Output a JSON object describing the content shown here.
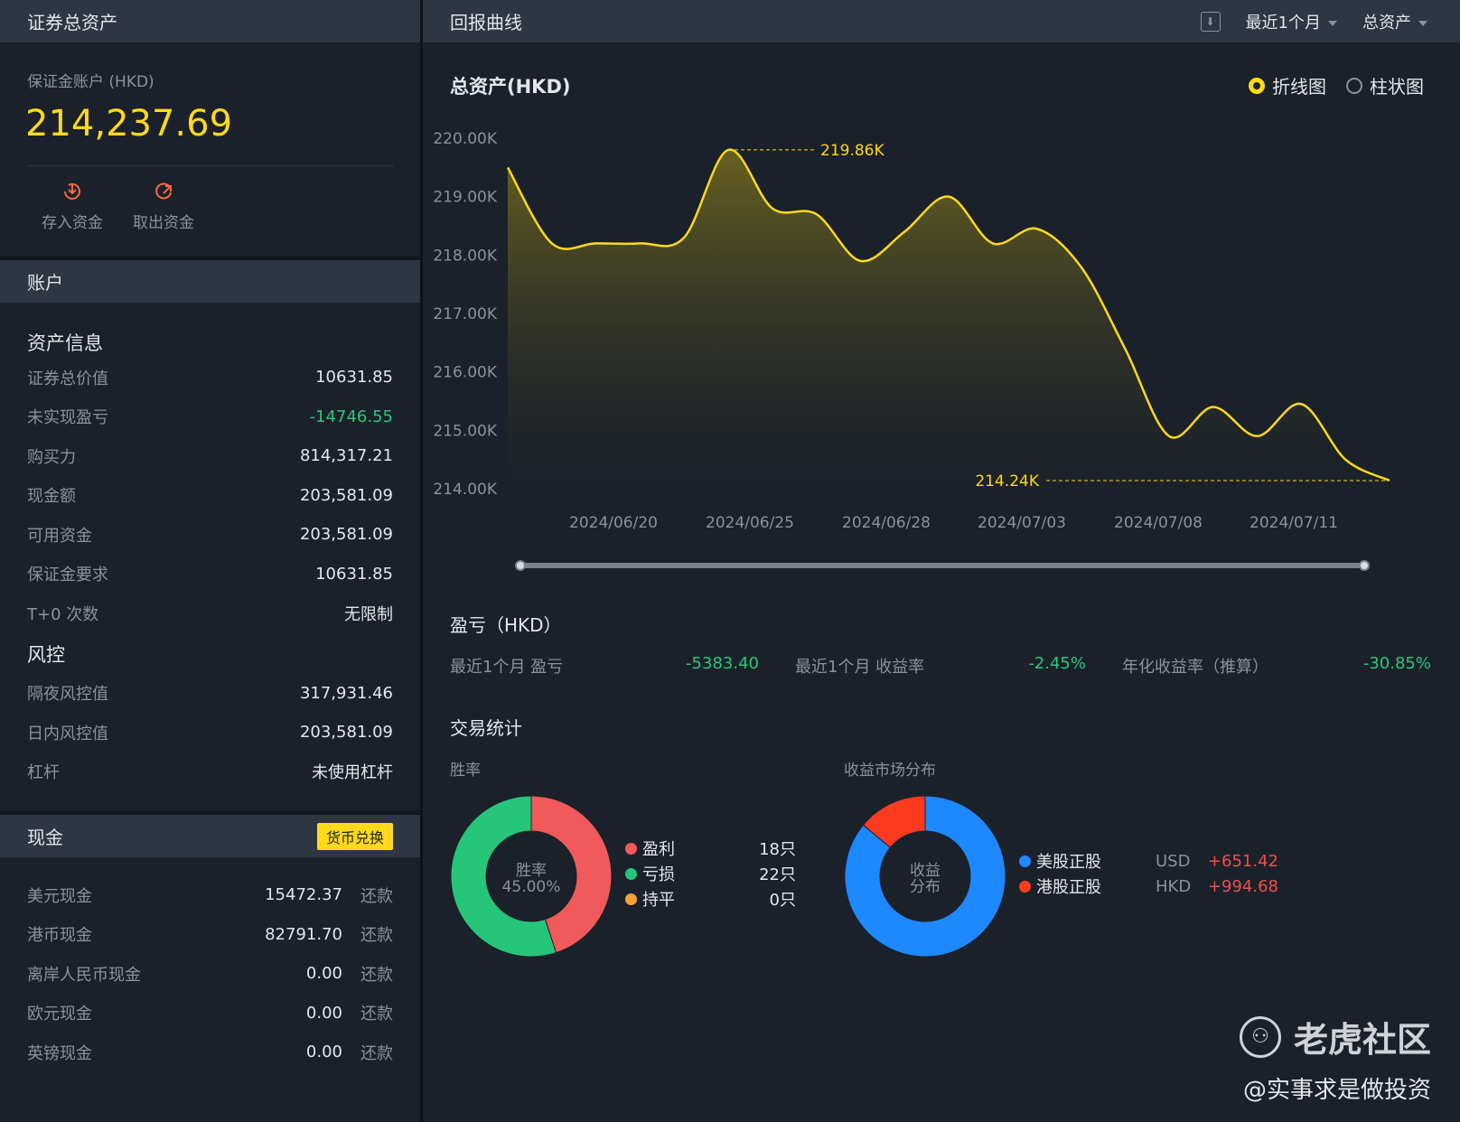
{
  "left": {
    "header_title": "证券总资产",
    "account_label": "保证金账户 (HKD)",
    "total_value": "214,237.69",
    "actions": [
      {
        "label": "存入资金",
        "icon": "deposit-icon"
      },
      {
        "label": "取出资金",
        "icon": "withdraw-icon"
      }
    ],
    "account_section": "账户",
    "asset_info_title": "资产信息",
    "asset_rows": [
      {
        "label": "证券总价值",
        "value": "10631.85"
      },
      {
        "label": "未实现盈亏",
        "value": "-14746.55"
      },
      {
        "label": "购买力",
        "value": "814,317.21"
      },
      {
        "label": "现金额",
        "value": "203,581.09"
      },
      {
        "label": "可用资金",
        "value": "203,581.09"
      },
      {
        "label": "保证金要求",
        "value": "10631.85"
      },
      {
        "label": "T+0 次数",
        "value": "无限制"
      }
    ],
    "risk_title": "风控",
    "risk_rows": [
      {
        "label": "隔夜风控值",
        "value": "317,931.46"
      },
      {
        "label": "日内风控值",
        "value": "203,581.09"
      },
      {
        "label": "杠杆",
        "value": "未使用杠杆"
      }
    ],
    "cash_section": "现金",
    "fx_button": "货币兑换",
    "repay_label": "还款",
    "cash_rows": [
      {
        "label": "美元现金",
        "value": "15472.37"
      },
      {
        "label": "港币现金",
        "value": "82791.70"
      },
      {
        "label": "离岸人民币现金",
        "value": "0.00"
      },
      {
        "label": "欧元现金",
        "value": "0.00"
      },
      {
        "label": "英镑现金",
        "value": "0.00"
      }
    ]
  },
  "right": {
    "header_title": "回报曲线",
    "period_select": "最近1个月",
    "metric_select": "总资产",
    "chart_title": "总资产(HKD)",
    "radio_line": "折线图",
    "radio_bar": "柱状图",
    "pl_title": "盈亏（HKD）",
    "pl_items": [
      {
        "label": "最近1个月 盈亏",
        "value": "-5383.40"
      },
      {
        "label": "最近1个月 收益率",
        "value": "-2.45%"
      },
      {
        "label": "年化收益率（推算）",
        "value": "-30.85%"
      }
    ],
    "trade_stats_title": "交易统计",
    "winrate_title": "胜率",
    "winrate_center_label": "胜率",
    "winrate_center_value": "45.00%",
    "winrate_legend": [
      {
        "label": "盈利",
        "count": "18只",
        "color": "#f05a5a"
      },
      {
        "label": "亏损",
        "count": "22只",
        "color": "#26c67a"
      },
      {
        "label": "持平",
        "count": "0只",
        "color": "#f7a13a"
      }
    ],
    "market_title": "收益市场分布",
    "market_center_line1": "收益",
    "market_center_line2": "分布",
    "market_legend": [
      {
        "label": "美股正股",
        "currency": "USD",
        "amount": "+651.42",
        "color": "#1e88ff"
      },
      {
        "label": "港股正股",
        "currency": "HKD",
        "amount": "+994.68",
        "color": "#ff3b1f"
      }
    ],
    "watermark_brand": "老虎社区",
    "watermark_user": "@实事求是做投资"
  },
  "chart_data": {
    "type": "line",
    "title": "总资产(HKD)",
    "x_ticks": [
      "2024/06/20",
      "2024/06/25",
      "2024/06/28",
      "2024/07/03",
      "2024/07/08",
      "2024/07/11"
    ],
    "y_ticks": [
      "220.00K",
      "219.00K",
      "218.00K",
      "217.00K",
      "216.00K",
      "215.00K",
      "214.00K"
    ],
    "ylim": [
      214000,
      220000
    ],
    "max_label": "219.86K",
    "min_label": "214.24K",
    "series": [
      {
        "values": [
          219500,
          218200,
          218200,
          218200,
          218300,
          219800,
          218800,
          218700,
          217900,
          218400,
          219000,
          218200,
          218450,
          217800,
          216400,
          214900,
          215400,
          214900,
          215450,
          214500,
          214140
        ]
      }
    ],
    "line_color": "#ffd91a",
    "grid": false
  },
  "winrate_chart": {
    "type": "pie",
    "values": [
      45,
      55
    ],
    "colors": [
      "#f05a5a",
      "#26c67a"
    ]
  },
  "market_chart": {
    "type": "pie",
    "values": [
      86,
      14
    ],
    "colors": [
      "#1e88ff",
      "#ff3b1f"
    ]
  }
}
